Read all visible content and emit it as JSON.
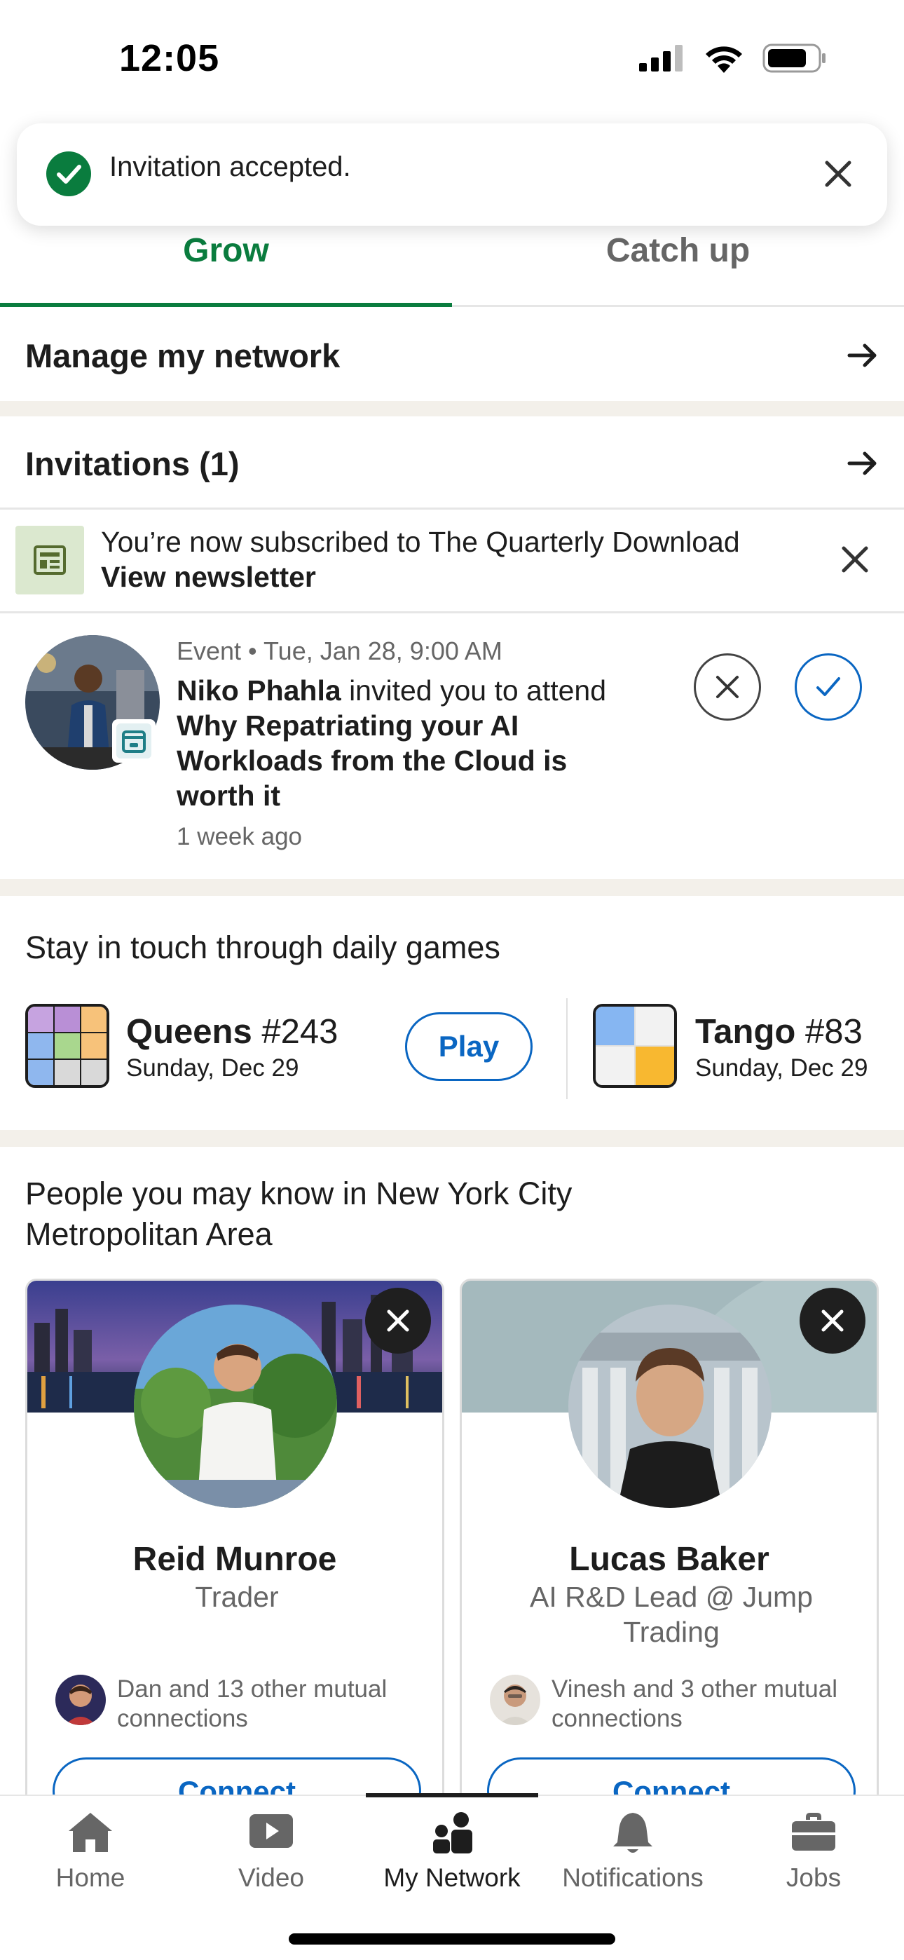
{
  "status_bar": {
    "time": "12:05"
  },
  "toast": {
    "message": "Invitation accepted."
  },
  "tabs": [
    {
      "label": "Grow",
      "active": true
    },
    {
      "label": "Catch up",
      "active": false
    }
  ],
  "manage_network": {
    "label": "Manage my network"
  },
  "invitations": {
    "label": "Invitations (1)"
  },
  "newsletter": {
    "message": "You’re now subscribed to The Quarterly Download",
    "link": "View newsletter"
  },
  "event_invite": {
    "meta": "Event • Tue, Jan 28, 9:00 AM",
    "inviter": "Niko Phahla",
    "action": " invited you to attend ",
    "event_title": "Why Repatriating your AI Workloads from the Cloud is worth it",
    "time_ago": "1 week ago"
  },
  "games": {
    "title": "Stay in touch through daily games",
    "items": [
      {
        "name": "Queens",
        "number": "#243",
        "date": "Sunday, Dec 29",
        "button": "Play"
      },
      {
        "name": "Tango",
        "number": "#83",
        "date": "Sunday, Dec 29"
      }
    ]
  },
  "people": {
    "title": "People you may know in New York City Metropolitan Area",
    "cards": [
      {
        "name": "Reid Munroe",
        "headline": "Trader",
        "mutual": "Dan and 13 other mutual connections",
        "button": "Connect"
      },
      {
        "name": "Lucas Baker",
        "headline": "AI R&D Lead @ Jump Trading",
        "mutual": "Vinesh and 3 other mutual connections",
        "button": "Connect"
      }
    ]
  },
  "bottom_nav": [
    {
      "label": "Home",
      "icon": "home-icon"
    },
    {
      "label": "Video",
      "icon": "video-icon"
    },
    {
      "label": "My Network",
      "icon": "my-network-icon",
      "active": true
    },
    {
      "label": "Notifications",
      "icon": "bell-icon"
    },
    {
      "label": "Jobs",
      "icon": "briefcase-icon"
    }
  ],
  "colors": {
    "brand_green": "#0a7c3e",
    "link_blue": "#0a66c2",
    "text_primary": "#1d1d1d",
    "text_secondary": "#666666"
  }
}
